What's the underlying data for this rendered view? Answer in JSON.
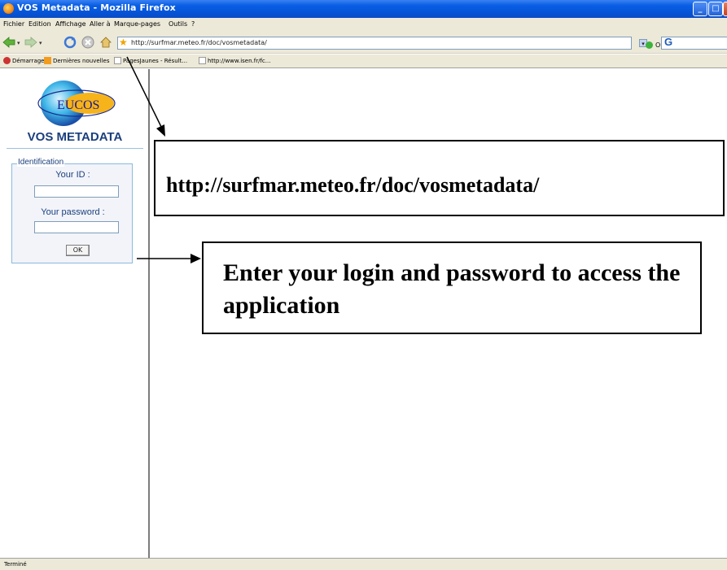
{
  "window": {
    "title": "VOS Metadata - Mozilla Firefox",
    "buttons": {
      "minimize": "_",
      "maximize": "□",
      "close": "X"
    }
  },
  "menu": [
    "Fichier",
    "Edition",
    "Affichage",
    "Aller à",
    "Marque-pages",
    "Outils",
    "?"
  ],
  "toolbar": {
    "url": "http://surfmar.meteo.fr/doc/vosmetadata/",
    "go_label": "OK"
  },
  "bookmarks": [
    "Démarrage",
    "Dernières nouvelles",
    "PagesJaunes - Résult...",
    "http://www.isen.fr/fc..."
  ],
  "sidebar": {
    "logo_text": "EUCOS",
    "title": "VOS METADATA",
    "form": {
      "legend": "Identification",
      "id_label": "Your ID :",
      "password_label": "Your password :",
      "ok_label": "OK"
    }
  },
  "annotations": {
    "url_callout": "http://surfmar.meteo.fr/doc/vosmetadata/",
    "login_callout": "Enter your login and password to access the application"
  },
  "status": {
    "text": "Terminé"
  },
  "colors": {
    "titlebar": "#0553d8",
    "chrome": "#ece9d8",
    "sidebar_text": "#1b3f7d",
    "fieldset_border": "#8bb9dc"
  }
}
